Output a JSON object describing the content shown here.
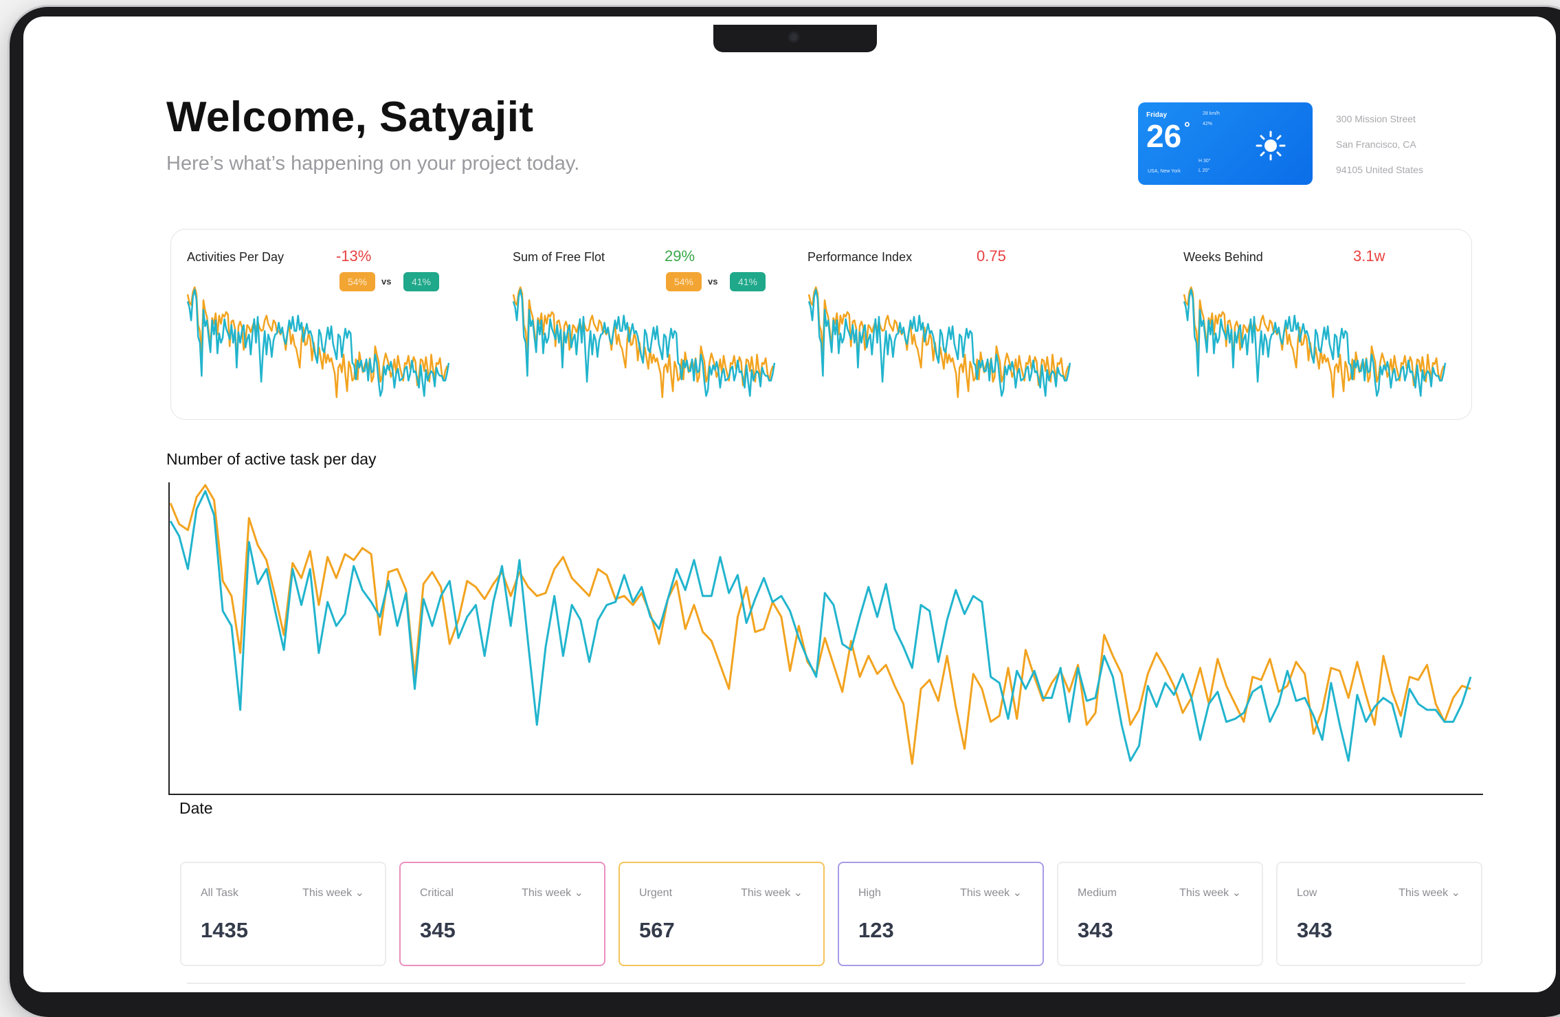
{
  "header": {
    "title": "Welcome, Satyajit",
    "subtitle": "Here’s what’s happening on your project today."
  },
  "weather": {
    "day": "Friday",
    "temperature": "26",
    "degree": "°",
    "wind": "28 km/h",
    "humidity": "42%",
    "high": "H 30°",
    "low": "L 20°",
    "location": "USA, New York",
    "condition_icon": "sun-icon"
  },
  "address": [
    "300 Mission Street",
    "San Francisco, CA",
    "94105 United States"
  ],
  "metrics": [
    {
      "label": "Activities Per Day",
      "value": "-13%",
      "value_color": "#e8403f",
      "pill_a": "54%",
      "pill_b": "41%",
      "vs": "vs"
    },
    {
      "label": "Sum of Free Flot",
      "value": "29%",
      "value_color": "#3aa84a",
      "pill_a": "54%",
      "pill_b": "41%",
      "vs": "vs"
    },
    {
      "label": "Performance Index",
      "value": "0.75",
      "value_color": "#e8403f"
    },
    {
      "label": "Weeks Behind",
      "value": "3.1w",
      "value_color": "#e8403f"
    }
  ],
  "main_chart": {
    "title": "Number of active task per day",
    "xlabel": "Date"
  },
  "colors": {
    "series_orange": "#f2a31f",
    "series_teal": "#21b4cd"
  },
  "chart_data": {
    "type": "line",
    "title": "Number of active task per day",
    "xlabel": "Date",
    "ylabel": "",
    "ylim": [
      0,
      100
    ],
    "x": [
      1,
      2,
      3,
      4,
      5,
      6,
      7,
      8,
      9,
      10,
      11,
      12,
      13,
      14,
      15,
      16,
      17,
      18,
      19,
      20,
      21,
      22,
      23,
      24,
      25,
      26,
      27,
      28,
      29,
      30,
      31,
      32,
      33,
      34,
      35,
      36,
      37,
      38,
      39,
      40,
      41,
      42,
      43,
      44,
      45,
      46,
      47,
      48,
      49,
      50,
      51,
      52,
      53,
      54,
      55,
      56,
      57,
      58,
      59,
      60,
      61,
      62,
      63,
      64,
      65,
      66,
      67,
      68,
      69,
      70,
      71,
      72,
      73,
      74,
      75,
      76,
      77,
      78,
      79,
      80,
      81,
      82,
      83,
      84,
      85,
      86,
      87,
      88,
      89,
      90,
      91,
      92,
      93,
      94,
      95,
      96,
      97,
      98,
      99,
      100,
      101,
      102,
      103,
      104,
      105,
      106,
      107,
      108,
      109,
      110,
      111,
      112,
      113,
      114,
      115,
      116,
      117,
      118,
      119,
      120,
      121,
      122,
      123,
      124,
      125,
      126,
      127,
      128,
      129,
      130,
      131,
      132,
      133,
      134,
      135,
      136,
      137,
      138,
      139,
      140,
      141,
      142,
      143,
      144,
      145,
      146,
      147,
      148,
      149,
      150
    ],
    "series": [
      {
        "values": [
          94,
          87,
          85,
          96,
          100,
          95,
          68,
          63,
          44,
          89,
          80,
          75,
          63,
          50,
          74,
          69,
          78,
          60,
          76,
          69,
          77,
          75,
          79,
          77,
          50,
          71,
          72,
          65,
          36,
          67,
          71,
          66,
          47,
          55,
          68,
          66,
          62,
          67,
          71,
          63,
          71,
          66,
          63,
          64,
          72,
          76,
          69,
          66,
          63,
          72,
          70,
          62,
          63,
          60,
          64,
          57,
          47,
          62,
          68,
          52,
          60,
          51,
          48,
          40,
          32,
          56,
          66,
          51,
          52,
          61,
          56,
          38,
          53,
          41,
          37,
          49,
          40,
          31,
          48,
          36,
          43,
          37,
          40,
          33,
          27,
          7,
          32,
          35,
          28,
          43,
          26,
          12,
          37,
          32,
          21,
          23,
          39,
          22,
          45,
          36,
          28,
          34,
          38,
          31,
          40,
          20,
          24,
          50,
          43,
          37,
          20,
          25,
          37,
          44,
          39,
          33,
          24,
          29,
          39,
          27,
          42,
          33,
          27,
          21,
          36,
          35,
          42,
          31,
          33,
          41,
          37,
          17,
          25,
          39,
          38,
          29,
          41,
          30,
          20,
          43,
          31,
          23,
          36,
          35,
          40,
          27,
          21,
          29,
          33,
          32
        ],
        "color": "#f2a31f"
      },
      {
        "values": [
          88,
          83,
          72,
          92,
          98,
          90,
          58,
          53,
          25,
          81,
          67,
          72,
          58,
          45,
          72,
          60,
          72,
          44,
          61,
          53,
          57,
          73,
          65,
          61,
          56,
          68,
          53,
          64,
          32,
          62,
          53,
          63,
          68,
          49,
          56,
          60,
          43,
          61,
          73,
          53,
          75,
          47,
          20,
          46,
          63,
          43,
          60,
          55,
          41,
          55,
          60,
          61,
          70,
          61,
          66,
          56,
          52,
          62,
          72,
          65,
          75,
          63,
          63,
          76,
          64,
          70,
          54,
          62,
          69,
          61,
          63,
          58,
          49,
          42,
          36,
          64,
          60,
          47,
          45,
          56,
          66,
          56,
          67,
          52,
          46,
          39,
          60,
          58,
          41,
          55,
          65,
          57,
          63,
          61,
          36,
          34,
          22,
          38,
          32,
          38,
          29,
          29,
          39,
          21,
          39,
          28,
          29,
          43,
          36,
          20,
          8,
          13,
          33,
          26,
          34,
          30,
          37,
          29,
          15,
          27,
          31,
          21,
          22,
          24,
          31,
          33,
          21,
          27,
          38,
          28,
          29,
          23,
          15,
          34,
          20,
          8,
          30,
          21,
          26,
          29,
          27,
          16,
          32,
          27,
          25,
          25,
          21,
          21,
          27,
          36
        ],
        "color": "#21b4cd"
      }
    ]
  }
}
